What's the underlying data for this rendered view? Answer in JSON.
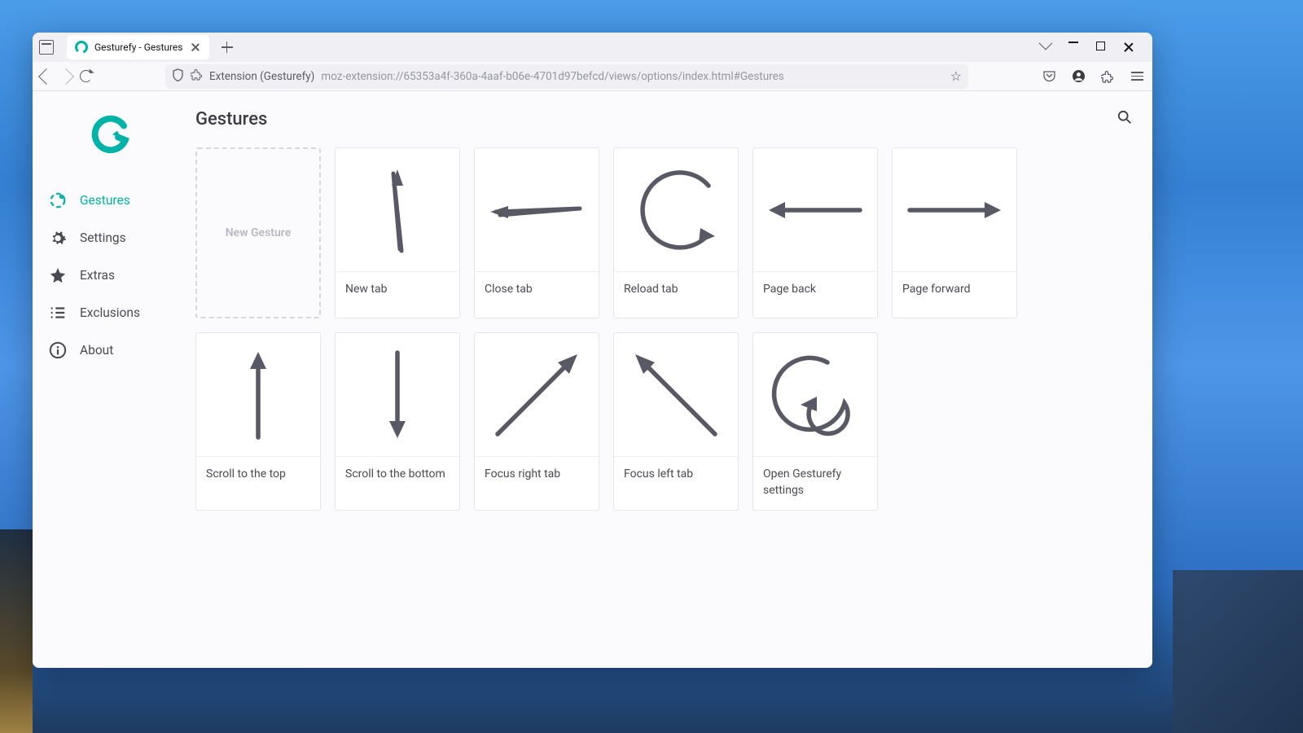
{
  "browser": {
    "tab_title": "Gesturefy - Gestures",
    "url_ext_label": "Extension (Gesturefy)",
    "url_path": "moz-extension://65353a4f-360a-4aaf-b06e-4701d97befcd/views/options/index.html#Gestures"
  },
  "sidebar": {
    "items": [
      {
        "label": "Gestures",
        "active": true
      },
      {
        "label": "Settings",
        "active": false
      },
      {
        "label": "Extras",
        "active": false
      },
      {
        "label": "Exclusions",
        "active": false
      },
      {
        "label": "About",
        "active": false
      }
    ]
  },
  "page": {
    "title": "Gestures",
    "new_gesture_label": "New Gesture"
  },
  "gestures": [
    {
      "label": "New tab",
      "shape": "up-down-narrow"
    },
    {
      "label": "Close tab",
      "shape": "right-left"
    },
    {
      "label": "Reload tab",
      "shape": "c-loop"
    },
    {
      "label": "Page back",
      "shape": "left"
    },
    {
      "label": "Page forward",
      "shape": "right"
    },
    {
      "label": "Scroll to the top",
      "shape": "up"
    },
    {
      "label": "Scroll to the bottom",
      "shape": "down"
    },
    {
      "label": "Focus right tab",
      "shape": "diag-up-right"
    },
    {
      "label": "Focus left tab",
      "shape": "diag-down-right"
    },
    {
      "label": "Open Gesturefy settings",
      "shape": "g-spiral"
    }
  ]
}
